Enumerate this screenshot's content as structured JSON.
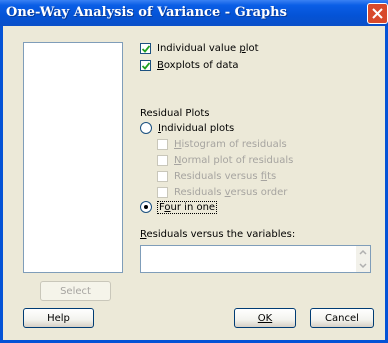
{
  "window": {
    "title": "One-Way Analysis of Variance - Graphs"
  },
  "icons": {
    "close": "close-x-icon",
    "scroll_up": "chevron-up-icon",
    "scroll_down": "chevron-down-icon"
  },
  "options": {
    "individual_value_plot": {
      "label_pre": "Individual value ",
      "label_u": "p",
      "label_post": "lot",
      "checked": true
    },
    "boxplots": {
      "label_pre": "",
      "label_u": "B",
      "label_post": "oxplots of data",
      "checked": true
    }
  },
  "residual_plots": {
    "heading": "Residual Plots",
    "individual_plots": {
      "label_pre": "",
      "label_u": "I",
      "label_post": "ndividual plots",
      "selected": false
    },
    "sub_options": [
      {
        "label_pre": "",
        "label_u": "H",
        "label_post": "istogram of residuals",
        "enabled": false
      },
      {
        "label_pre": "",
        "label_u": "N",
        "label_post": "ormal plot of residuals",
        "enabled": false
      },
      {
        "label_pre": "Residuals versus ",
        "label_u": "f",
        "label_post": "its",
        "enabled": false
      },
      {
        "label_pre": "Residuals ",
        "label_u": "v",
        "label_post": "ersus order",
        "enabled": false
      }
    ],
    "four_in_one": {
      "label_pre": "F",
      "label_u": "o",
      "label_post": "ur in one",
      "selected": true
    }
  },
  "variables": {
    "label_pre": "",
    "label_u": "R",
    "label_post": "esiduals versus the variables:",
    "value": ""
  },
  "buttons": {
    "select": "Select",
    "help": "Help",
    "ok": "OK",
    "cancel": "Cancel"
  }
}
